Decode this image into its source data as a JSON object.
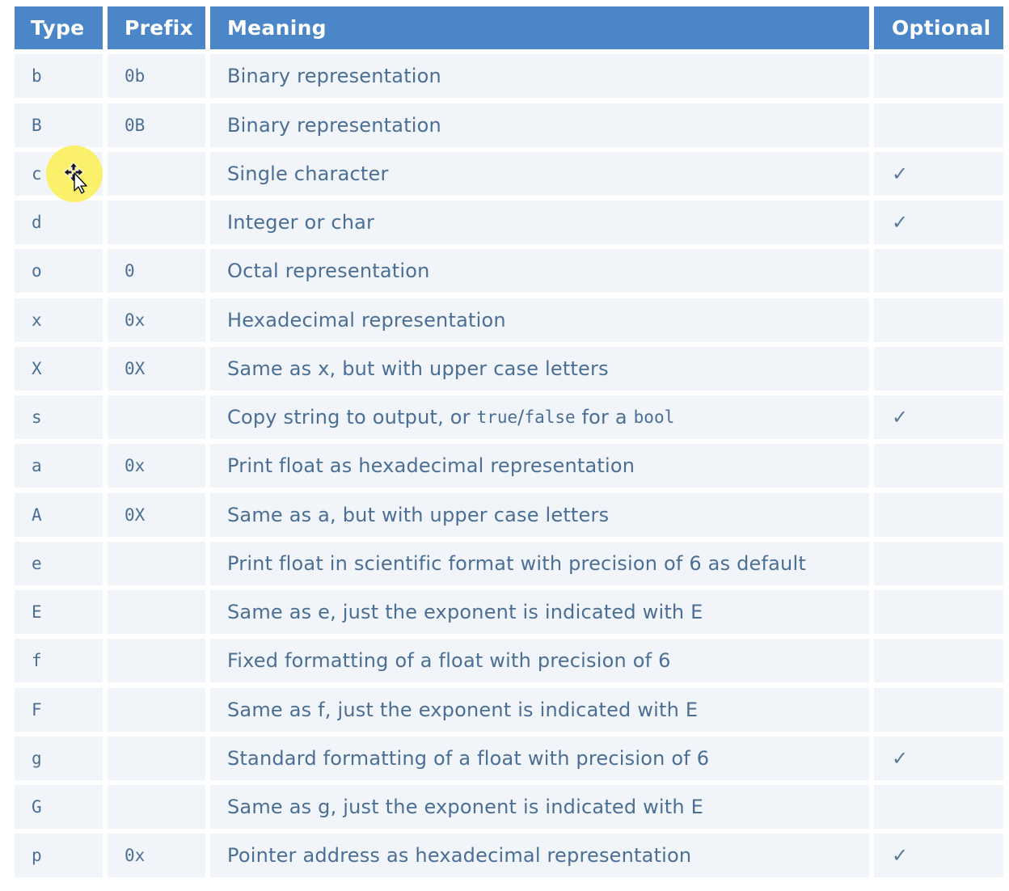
{
  "table": {
    "headers": [
      "Type",
      "Prefix",
      "Meaning",
      "Optional"
    ],
    "rows": [
      {
        "type": "b",
        "prefix": "0b",
        "meaning": [
          {
            "t": "Binary representation"
          }
        ],
        "optional": ""
      },
      {
        "type": "B",
        "prefix": "0B",
        "meaning": [
          {
            "t": "Binary representation"
          }
        ],
        "optional": ""
      },
      {
        "type": "c",
        "prefix": "",
        "meaning": [
          {
            "t": "Single character"
          }
        ],
        "optional": "✓"
      },
      {
        "type": "d",
        "prefix": "",
        "meaning": [
          {
            "t": "Integer or char"
          }
        ],
        "optional": "✓"
      },
      {
        "type": "o",
        "prefix": "0",
        "meaning": [
          {
            "t": "Octal representation"
          }
        ],
        "optional": ""
      },
      {
        "type": "x",
        "prefix": "0x",
        "meaning": [
          {
            "t": "Hexadecimal representation"
          }
        ],
        "optional": ""
      },
      {
        "type": "X",
        "prefix": "0X",
        "meaning": [
          {
            "t": "Same as x, but with upper case letters"
          }
        ],
        "optional": ""
      },
      {
        "type": "s",
        "prefix": "",
        "meaning": [
          {
            "t": "Copy string to output, or "
          },
          {
            "t": "true",
            "code": true
          },
          {
            "t": "/"
          },
          {
            "t": "false",
            "code": true
          },
          {
            "t": " for a "
          },
          {
            "t": "bool",
            "code": true
          }
        ],
        "optional": "✓"
      },
      {
        "type": "a",
        "prefix": "0x",
        "meaning": [
          {
            "t": "Print float as hexadecimal representation"
          }
        ],
        "optional": ""
      },
      {
        "type": "A",
        "prefix": "0X",
        "meaning": [
          {
            "t": "Same as a, but with upper case letters"
          }
        ],
        "optional": ""
      },
      {
        "type": "e",
        "prefix": "",
        "meaning": [
          {
            "t": "Print float in scientific format with precision of 6 as default"
          }
        ],
        "optional": ""
      },
      {
        "type": "E",
        "prefix": "",
        "meaning": [
          {
            "t": "Same as e, just the exponent is indicated with E"
          }
        ],
        "optional": ""
      },
      {
        "type": "f",
        "prefix": "",
        "meaning": [
          {
            "t": "Fixed formatting of a float with precision of 6"
          }
        ],
        "optional": ""
      },
      {
        "type": "F",
        "prefix": "",
        "meaning": [
          {
            "t": "Same as f, just the exponent is indicated with E"
          }
        ],
        "optional": ""
      },
      {
        "type": "g",
        "prefix": "",
        "meaning": [
          {
            "t": "Standard formatting of a float with precision of 6"
          }
        ],
        "optional": "✓"
      },
      {
        "type": "G",
        "prefix": "",
        "meaning": [
          {
            "t": "Same as g, just the exponent is indicated with E"
          }
        ],
        "optional": ""
      },
      {
        "type": "p",
        "prefix": "0x",
        "meaning": [
          {
            "t": "Pointer address as hexadecimal representation"
          }
        ],
        "optional": "✓"
      }
    ]
  },
  "cursor": {
    "icon": "move-cursor-icon",
    "highlight_color": "#fcee50"
  },
  "colors": {
    "header_bg": "#4a86c8",
    "header_text": "#ffffff",
    "cell_bg": "#f1f5fa",
    "cell_text": "#4b6f94"
  }
}
